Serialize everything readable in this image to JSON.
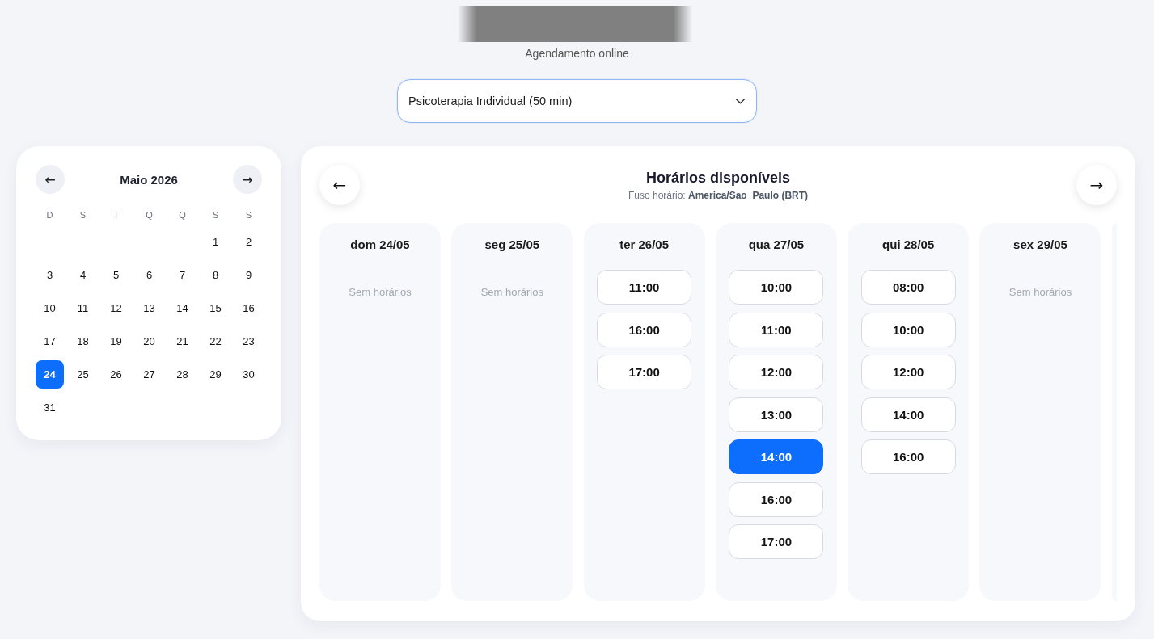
{
  "header": {
    "subtitle": "Agendamento online"
  },
  "service_select": {
    "value": "Psicoterapia Individual (50 min)"
  },
  "calendar": {
    "prev": "←",
    "month": "Maio 2026",
    "next": "→",
    "weekdays": [
      "D",
      "S",
      "T",
      "Q",
      "Q",
      "S",
      "S"
    ],
    "weeks": [
      [
        {
          "label": "1",
          "selected": false
        },
        {
          "label": "2",
          "selected": false
        }
      ],
      [
        {
          "label": "3",
          "selected": false
        },
        {
          "label": "4",
          "selected": false
        },
        {
          "label": "5",
          "selected": false
        },
        {
          "label": "6",
          "selected": false
        },
        {
          "label": "7",
          "selected": false
        },
        {
          "label": "8",
          "selected": false
        },
        {
          "label": "9",
          "selected": false
        }
      ],
      [
        {
          "label": "10",
          "selected": false
        },
        {
          "label": "11",
          "selected": false
        },
        {
          "label": "12",
          "selected": false
        },
        {
          "label": "13",
          "selected": false
        },
        {
          "label": "14",
          "selected": false
        },
        {
          "label": "15",
          "selected": false
        },
        {
          "label": "16",
          "selected": false
        }
      ],
      [
        {
          "label": "17",
          "selected": false
        },
        {
          "label": "18",
          "selected": false
        },
        {
          "label": "19",
          "selected": false
        },
        {
          "label": "20",
          "selected": false
        },
        {
          "label": "21",
          "selected": false
        },
        {
          "label": "22",
          "selected": false
        },
        {
          "label": "23",
          "selected": false
        }
      ],
      [
        {
          "label": "24",
          "selected": true
        },
        {
          "label": "25",
          "selected": false
        },
        {
          "label": "26",
          "selected": false
        },
        {
          "label": "27",
          "selected": false
        },
        {
          "label": "28",
          "selected": false
        },
        {
          "label": "29",
          "selected": false
        },
        {
          "label": "30",
          "selected": false
        }
      ],
      [
        {
          "label": "31",
          "selected": false
        }
      ]
    ]
  },
  "schedule": {
    "prev": "←",
    "title": "Horários disponíveis",
    "timezone": "Fuso horário: **America/Sao_Paulo (BRT)**",
    "next": "→",
    "days": [
      {
        "kind": "day",
        "label": "dom 24/05",
        "note": "Sem horários"
      },
      {
        "kind": "day",
        "label": "seg 25/05",
        "note": "Sem horários"
      },
      {
        "kind": "day",
        "label": "ter 26/05",
        "slots": [
          {
            "time": "11:00",
            "selected": false
          },
          {
            "time": "16:00",
            "selected": false
          },
          {
            "time": "17:00",
            "selected": false
          }
        ]
      },
      {
        "kind": "day",
        "label": "qua 27/05",
        "slots": [
          {
            "time": "10:00",
            "selected": false
          },
          {
            "time": "11:00",
            "selected": false
          },
          {
            "time": "12:00",
            "selected": false
          },
          {
            "time": "13:00",
            "selected": false
          },
          {
            "time": "14:00",
            "selected": true
          },
          {
            "time": "16:00",
            "selected": false
          },
          {
            "time": "17:00",
            "selected": false
          }
        ]
      },
      {
        "kind": "day",
        "label": "qui 28/05",
        "slots": [
          {
            "time": "08:00",
            "selected": false
          },
          {
            "time": "10:00",
            "selected": false
          },
          {
            "time": "12:00",
            "selected": false
          },
          {
            "time": "14:00",
            "selected": false
          },
          {
            "time": "16:00",
            "selected": false
          }
        ]
      },
      {
        "kind": "day",
        "label": "sex 29/05",
        "note": "Sem horários"
      },
      {
        "kind": "clipped"
      }
    ]
  }
}
